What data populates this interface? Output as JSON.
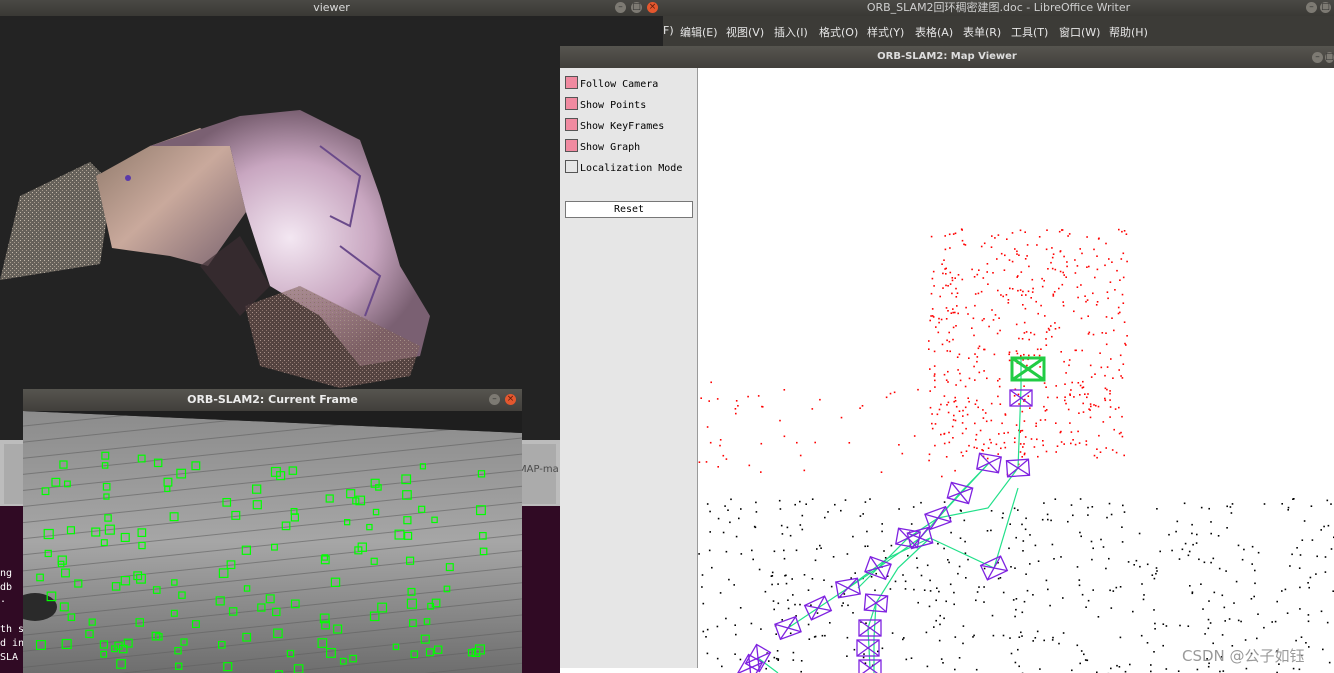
{
  "viewer": {
    "title": "viewer"
  },
  "writer": {
    "title": "ORB_SLAM2回环稠密建图.doc - LibreOffice Writer",
    "menu": [
      "F)",
      "编辑(E)",
      "视图(V)",
      "插入(I)",
      "格式(O)",
      "样式(Y)",
      "表格(A)",
      "表单(R)",
      "工具(T)",
      "窗口(W)",
      "帮助(H)"
    ]
  },
  "terminal": {
    "lines": [
      "ng",
      "db",
      " .",
      "",
      "th s",
      "d in",
      " SLA"
    ],
    "tab_text": "MAP-ma"
  },
  "map_viewer": {
    "title": "ORB-SLAM2: Map Viewer",
    "options": [
      {
        "label": "Follow Camera",
        "checked": true
      },
      {
        "label": "Show Points",
        "checked": true
      },
      {
        "label": "Show KeyFrames",
        "checked": true
      },
      {
        "label": "Show Graph",
        "checked": true
      },
      {
        "label": "Localization Mode",
        "checked": false
      }
    ],
    "reset_label": "Reset",
    "colors": {
      "map_points": "#ff0000",
      "ref_points": "#000000",
      "keyframe": "#7f22e0",
      "graph": "#22e08a",
      "camera": "#22cc44"
    }
  },
  "current_frame": {
    "title": "ORB-SLAM2: Current Frame",
    "feature_color": "#00ff00"
  },
  "watermark": "CSDN @公子如钰"
}
